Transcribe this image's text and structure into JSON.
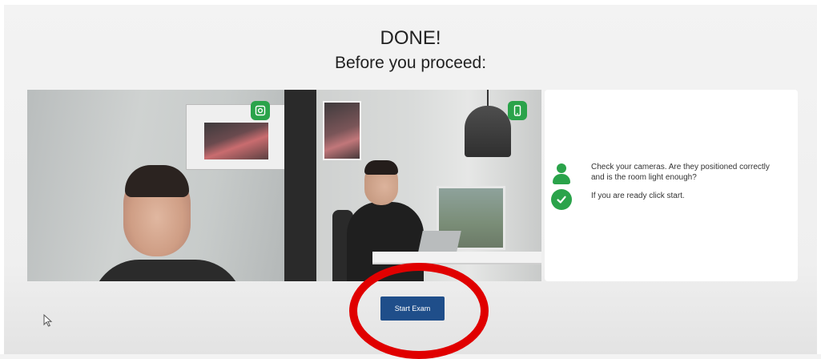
{
  "header": {
    "title": "DONE!",
    "subtitle": "Before you proceed:"
  },
  "cameras": [
    {
      "name": "webcam",
      "icon": "webcam-icon"
    },
    {
      "name": "phone-camera",
      "icon": "smartphone-icon"
    }
  ],
  "info": {
    "check_text": "Check your cameras. Are they positioned correctly and is the room light enough?",
    "ready_text": "If you are ready click start.",
    "icons": [
      "user-icon",
      "check-circle-icon"
    ]
  },
  "actions": {
    "start_label": "Start Exam"
  },
  "colors": {
    "accent_green": "#2aa34a",
    "button_blue": "#1f4e8a",
    "highlight_red": "#e00000"
  }
}
